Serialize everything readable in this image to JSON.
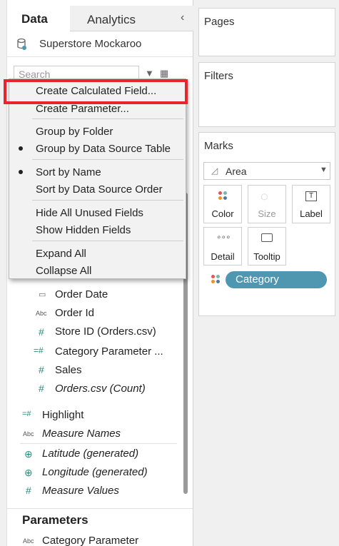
{
  "tabs": {
    "data": "Data",
    "analytics": "Analytics"
  },
  "datasource": {
    "name": "Superstore Mockaroo"
  },
  "search": {
    "placeholder": "Search"
  },
  "context_menu": {
    "items": [
      "Create Calculated Field...",
      "Create Parameter...",
      "Group by Folder",
      "Group by Data Source Table",
      "Sort by Name",
      "Sort by Data Source Order",
      "Hide All Unused Fields",
      "Show Hidden Fields",
      "Expand All",
      "Collapse All"
    ],
    "checked": [
      "Group by Data Source Table",
      "Sort by Name"
    ]
  },
  "fields": {
    "order_date": "Order Date",
    "order_id": "Order Id",
    "store_id": "Store ID (Orders.csv)",
    "category_parameter_trunc": "Category Parameter ...",
    "sales": "Sales",
    "orders_count": "Orders.csv (Count)",
    "highlight": "Highlight",
    "measure_names": "Measure Names",
    "latitude": "Latitude (generated)",
    "longitude": "Longitude (generated)",
    "measure_values": "Measure Values"
  },
  "icons": {
    "date": "📅",
    "abc": "Abc",
    "hash": "#",
    "globe": "⊕"
  },
  "parameters": {
    "header": "Parameters",
    "items": [
      "Category Parameter"
    ]
  },
  "right_panels": {
    "pages": "Pages",
    "filters": "Filters",
    "marks": "Marks"
  },
  "marks": {
    "type": "Area",
    "buttons": {
      "color": "Color",
      "size": "Size",
      "label": "Label",
      "detail": "Detail",
      "tooltip": "Tooltip"
    },
    "pill": "Category"
  },
  "colors": {
    "highlight": "#e8252c",
    "pill": "#4f97b0",
    "field_icon": "#2b8a7e"
  }
}
